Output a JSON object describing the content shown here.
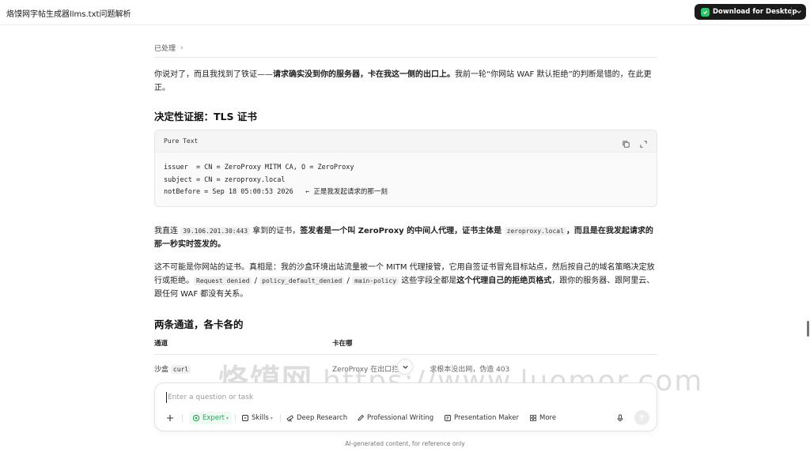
{
  "window": {
    "title": "烙馍网字帖生成器llms.txt问题解析"
  },
  "header": {
    "download_label": "Download for Desktop"
  },
  "message": {
    "processed_label": "已处理",
    "intro": {
      "pre": "你说对了，而且我找到了铁证——",
      "bold": "请求确实没到你的服务器，卡在我这一侧的出口上。",
      "post": "我前一轮“你网站 WAF 默认拒绝”的判断是错的，在此更正。"
    },
    "section1_title": "决定性证据：TLS 证书",
    "code": {
      "lang": "Pure Text",
      "lines": [
        "issuer  = CN = ZeroProxy MITM CA, O = ZeroProxy",
        "subject = CN = zeroproxy.local",
        "notBefore = Sep 18 05:00:53 2026   ← 正是我发起请求的那一刻"
      ]
    },
    "para2": {
      "t1": "我直连 ",
      "code1": "39.106.201.30:443",
      "t2": " 拿到的证书，",
      "b1": "签发者是一个叫 ZeroProxy 的中间人代理，证书主体是 ",
      "code2": "zeroproxy.local",
      "b2": "，而且是在我发起请求的那一秒实时签发的。"
    },
    "para3": {
      "t1": "这不可能是你网站的证书。真相是：我的沙盒环境出站流量被一个 MITM 代理接管，它用自签证书冒充目标站点，然后按自己的域名策略决定放行或拒绝。",
      "code1": "Request denied",
      "sep1": " / ",
      "code2": "policy_default_denied",
      "sep2": " / ",
      "code3": "main-policy",
      "t2": " 这些字段全都是",
      "b1": "这个代理自己的拒绝页格式",
      "t3": "，跟你的服务器、跟阿里云、跟任何 WAF 都没有关系。"
    },
    "section2_title": "两条通道，各卡各的",
    "table": {
      "headers": [
        "通道",
        "卡在哪"
      ],
      "rows": [
        {
          "channel_text": "沙盒 ",
          "channel_code": "curl",
          "where_a": "ZeroProxy 在出口拦截",
          "where_b": "求根本没出网，伪造 403"
        }
      ]
    }
  },
  "watermark": {
    "brand": "烙馍网",
    "url": "https://www.luomor.com"
  },
  "composer": {
    "placeholder": "Enter a question or task",
    "tools": {
      "expert": "Expert",
      "skills": "Skills",
      "deep_research": "Deep Research",
      "professional_writing": "Professional Writing",
      "presentation_maker": "Presentation Maker",
      "more": "More"
    }
  },
  "footer": {
    "notice": "AI-generated content, for reference only"
  },
  "colors": {
    "accent_green": "#2aa35c",
    "button_dark": "#1b1b1b"
  }
}
